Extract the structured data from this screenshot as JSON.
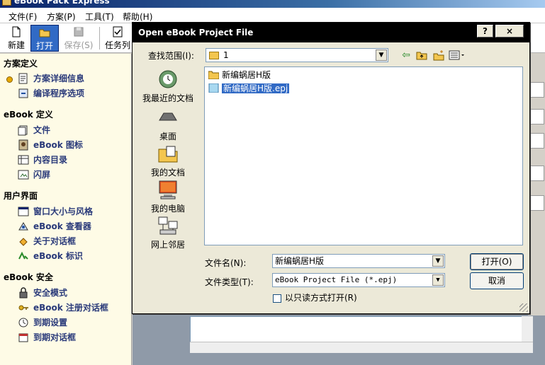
{
  "app": {
    "title": "eBook Pack Express"
  },
  "menu": {
    "file": "文件(F)",
    "scheme": "方案(P)",
    "tools": "工具(T)",
    "help": "帮助(H)"
  },
  "toolbar": {
    "new": "新建",
    "open": "打开",
    "save": "保存(S)",
    "tasks": "任务列"
  },
  "sidebar": {
    "groups": [
      "方案定义",
      "eBook 定义",
      "用户界面",
      "eBook 安全"
    ],
    "items": [
      "方案详细信息",
      "编译程序选项",
      "文件",
      "eBook 图标",
      "内容目录",
      "闪屏",
      "窗口大小与风格",
      "eBook 查看器",
      "关于对话框",
      "eBook 标识",
      "安全模式",
      "eBook 注册对话框",
      "到期设置",
      "到期对话框"
    ]
  },
  "dialog": {
    "title": "Open eBook Project File",
    "help_btn": "?",
    "close_btn": "×",
    "lookin_label": "查找范围(I):",
    "lookin_value": "1",
    "places": [
      "我最近的文档",
      "桌面",
      "我的文档",
      "我的电脑",
      "网上邻居"
    ],
    "files": [
      "新编蜗居H版",
      "新编蜗居H版.epj"
    ],
    "filename_label": "文件名(N):",
    "filename_value": "新编蜗居H版",
    "filetype_label": "文件类型(T):",
    "filetype_value": "eBook Project File (*.epj)",
    "open_button": "打开(O)",
    "cancel_button": "取消",
    "readonly_label": "以只读方式打开(R)"
  }
}
